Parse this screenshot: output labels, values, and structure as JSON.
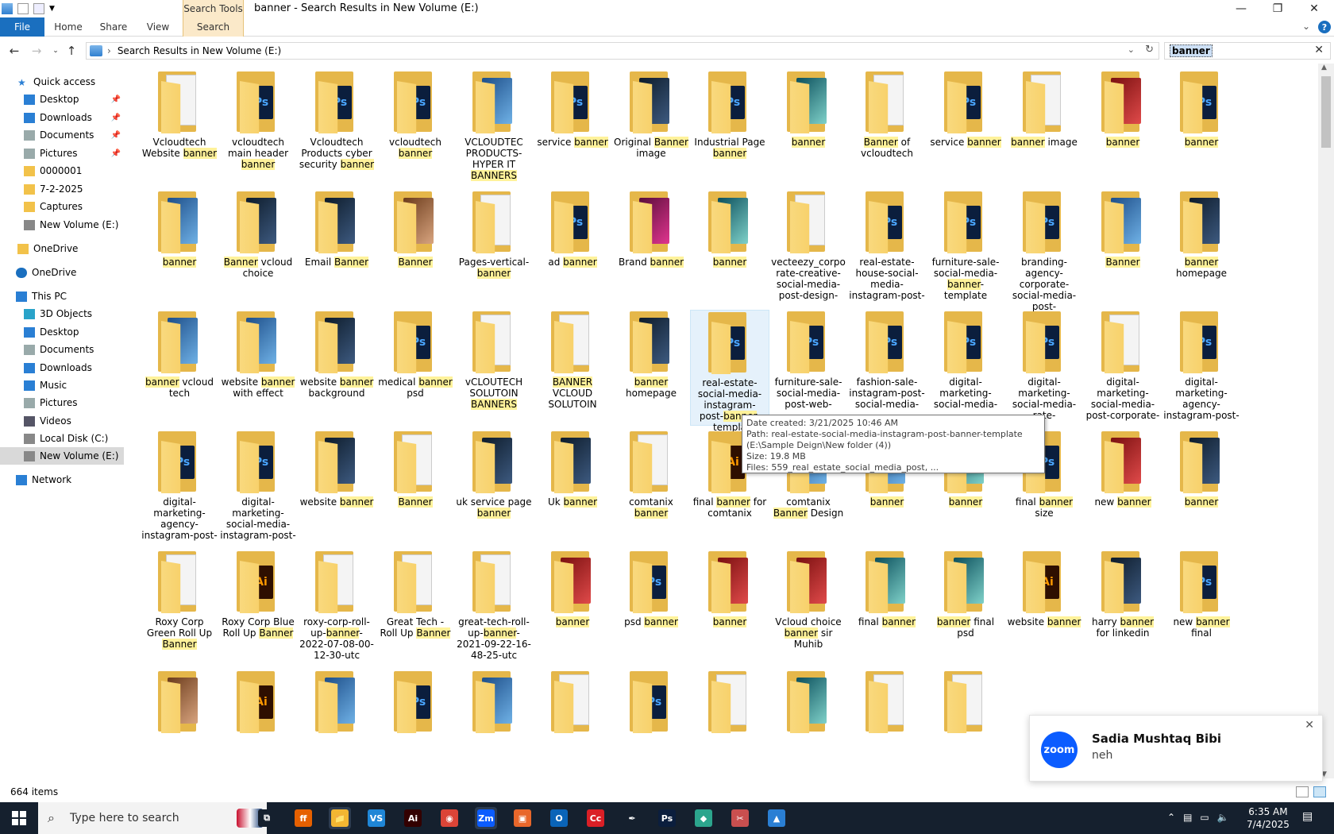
{
  "window": {
    "title": "banner - Search Results in New Volume (E:)",
    "context_group": "Search Tools",
    "min": "—",
    "max": "❐",
    "close": "✕"
  },
  "ribbon": {
    "tabs": [
      "File",
      "Home",
      "Share",
      "View",
      "Search"
    ],
    "help": "?"
  },
  "address": {
    "path": "Search Results in New Volume (E:)",
    "search_value": "banner"
  },
  "nav": {
    "items": [
      {
        "label": "Quick access",
        "icon": "star-icon"
      },
      {
        "label": "Desktop",
        "icon": "desktop-icon",
        "pinned": true
      },
      {
        "label": "Downloads",
        "icon": "download-icon",
        "pinned": true
      },
      {
        "label": "Documents",
        "icon": "documents-icon",
        "pinned": true
      },
      {
        "label": "Pictures",
        "icon": "pictures-icon",
        "pinned": true
      },
      {
        "label": "0000001",
        "icon": "folder-icon"
      },
      {
        "label": "7-2-2025",
        "icon": "folder-icon"
      },
      {
        "label": "Captures",
        "icon": "folder-icon"
      },
      {
        "label": "New Volume (E:)",
        "icon": "drive-icon"
      },
      {
        "label": "OneDrive",
        "icon": "folder-icon"
      },
      {
        "label": "OneDrive",
        "icon": "cloud-icon"
      },
      {
        "label": "This PC",
        "icon": "pc-icon"
      },
      {
        "label": "3D Objects",
        "icon": "3d-objects-icon"
      },
      {
        "label": "Desktop",
        "icon": "desktop-icon"
      },
      {
        "label": "Documents",
        "icon": "documents-icon"
      },
      {
        "label": "Downloads",
        "icon": "download-icon"
      },
      {
        "label": "Music",
        "icon": "music-icon"
      },
      {
        "label": "Pictures",
        "icon": "pictures-icon"
      },
      {
        "label": "Videos",
        "icon": "videos-icon"
      },
      {
        "label": "Local Disk (C:)",
        "icon": "drive-icon"
      },
      {
        "label": "New Volume (E:)",
        "icon": "drive-icon",
        "selected": true
      },
      {
        "label": "Network",
        "icon": "network-icon"
      }
    ]
  },
  "files": [
    [
      {
        "pre": "Vcloudtech Website ",
        "hl": "banner",
        "post": "",
        "kind": "doc"
      },
      {
        "pre": "vcloudtech main header ",
        "hl": "banner",
        "post": "",
        "kind": "psd"
      },
      {
        "pre": "Vcloudtech Products cyber security ",
        "hl": "banner",
        "post": "",
        "kind": "psd"
      },
      {
        "pre": "vcloudtech ",
        "hl": "banner",
        "post": "",
        "kind": "psd"
      },
      {
        "pre": "VCLOUDTEC PRODUCTS-HYPER IT ",
        "hl": "BANNERS",
        "post": "",
        "kind": "img-blue"
      },
      {
        "pre": "service ",
        "hl": "banner",
        "post": "",
        "kind": "psd"
      },
      {
        "pre": "Original ",
        "hl": "Banner",
        "post": " image",
        "kind": "img-dark"
      },
      {
        "pre": "Industrial Page ",
        "hl": "banner",
        "post": "",
        "kind": "psd"
      },
      {
        "pre": "",
        "hl": "banner",
        "post": "",
        "kind": "img-teal"
      },
      {
        "pre": "",
        "hl": "Banner",
        "post": " of vcloudtech",
        "kind": "doc"
      },
      {
        "pre": "service ",
        "hl": "banner",
        "post": "",
        "kind": "psd"
      },
      {
        "pre": "",
        "hl": "banner",
        "post": " image",
        "kind": "doc"
      },
      {
        "pre": "",
        "hl": "banner",
        "post": "",
        "kind": "img-red"
      },
      {
        "pre": "",
        "hl": "banner",
        "post": "",
        "kind": "psd"
      }
    ],
    [
      {
        "pre": "",
        "hl": "banner",
        "post": "",
        "kind": "img-blue"
      },
      {
        "pre": "",
        "hl": "Banner",
        "post": " vcloud choice",
        "kind": "img-dark"
      },
      {
        "pre": "Email ",
        "hl": "Banner",
        "post": "",
        "kind": "img-dark"
      },
      {
        "pre": "",
        "hl": "Banner",
        "post": "",
        "kind": "img-brown"
      },
      {
        "pre": "Pages-vertical-",
        "hl": "banner",
        "post": "",
        "kind": "doc"
      },
      {
        "pre": "ad ",
        "hl": "banner",
        "post": "",
        "kind": "psd"
      },
      {
        "pre": "Brand ",
        "hl": "banner",
        "post": "",
        "kind": "img-pink"
      },
      {
        "pre": "",
        "hl": "banner",
        "post": "",
        "kind": "img-teal"
      },
      {
        "pre": "vecteezy_corporate-creative-social-media-post-design-",
        "hl": "",
        "post": "",
        "kind": "doc"
      },
      {
        "pre": "real-estate-house-social-media-instagram-post-",
        "hl": "",
        "post": "",
        "kind": "psd"
      },
      {
        "pre": "furniture-sale-social-media-",
        "hl": "banner",
        "post": "-template",
        "kind": "psd"
      },
      {
        "pre": "branding-agency-corporate-social-media-post-",
        "hl": "",
        "post": "",
        "kind": "psd"
      },
      {
        "pre": "",
        "hl": "Banner",
        "post": "",
        "kind": "img-blue"
      },
      {
        "pre": "",
        "hl": "banner",
        "post": " homepage",
        "kind": "img-dark"
      }
    ],
    [
      {
        "pre": "",
        "hl": "banner",
        "post": " vcloud tech",
        "kind": "img-blue"
      },
      {
        "pre": "website ",
        "hl": "banner",
        "post": " with effect",
        "kind": "img-blue"
      },
      {
        "pre": "website ",
        "hl": "banner",
        "post": " background",
        "kind": "img-dark"
      },
      {
        "pre": "medical ",
        "hl": "banner",
        "post": " psd",
        "kind": "psd"
      },
      {
        "pre": "vCLOUTECH SOLUTOIN ",
        "hl": "BANNERS",
        "post": "",
        "kind": "doc"
      },
      {
        "pre": "",
        "hl": "BANNER",
        "post": " VCLOUD SOLUTOIN",
        "kind": "doc"
      },
      {
        "pre": "",
        "hl": "banner",
        "post": " homepage",
        "kind": "img-dark"
      },
      {
        "pre": "real-estate-social-media-instagram-post-",
        "hl": "banner",
        "post": "-templa",
        "kind": "psd",
        "hover": true
      },
      {
        "pre": "furniture-sale-social-media-post-web-",
        "hl": "",
        "post": "",
        "kind": "psd"
      },
      {
        "pre": "fashion-sale-instagram-post-social-media-",
        "hl": "",
        "post": "",
        "kind": "psd"
      },
      {
        "pre": "digital-marketing-social-media-",
        "hl": "",
        "post": "",
        "kind": "psd"
      },
      {
        "pre": "digital-marketing-social-media-",
        "hl": "",
        "post": "rate-",
        "kind": "psd"
      },
      {
        "pre": "digital-marketing-social-media-post-corporate-",
        "hl": "",
        "post": "",
        "kind": "doc"
      },
      {
        "pre": "digital-marketing-agency-instagram-post-",
        "hl": "",
        "post": "",
        "kind": "psd"
      }
    ],
    [
      {
        "pre": "digital-marketing-agency-instagram-post-",
        "hl": "",
        "post": "",
        "kind": "psd"
      },
      {
        "pre": "digital-marketing-social-media-instagram-post-",
        "hl": "",
        "post": "",
        "kind": "psd"
      },
      {
        "pre": "website ",
        "hl": "banner",
        "post": "",
        "kind": "img-dark"
      },
      {
        "pre": "",
        "hl": "Banner",
        "post": "",
        "kind": "doc"
      },
      {
        "pre": "uk service page ",
        "hl": "banner",
        "post": "",
        "kind": "img-dark"
      },
      {
        "pre": "Uk ",
        "hl": "banner",
        "post": "",
        "kind": "img-dark"
      },
      {
        "pre": "comtanix ",
        "hl": "banner",
        "post": "",
        "kind": "doc"
      },
      {
        "pre": "final ",
        "hl": "banner",
        "post": " for comtanix",
        "kind": "ai"
      },
      {
        "pre": "comtanix ",
        "hl": "Banner",
        "post": " Design",
        "kind": "img-blue"
      },
      {
        "pre": "",
        "hl": "banner",
        "post": "",
        "kind": "img-blue"
      },
      {
        "pre": "",
        "hl": "banner",
        "post": "",
        "kind": "img-teal"
      },
      {
        "pre": "final ",
        "hl": "banner",
        "post": " size",
        "kind": "psd"
      },
      {
        "pre": "new ",
        "hl": "banner",
        "post": "",
        "kind": "img-red"
      },
      {
        "pre": "",
        "hl": "banner",
        "post": "",
        "kind": "img-dark"
      }
    ],
    [
      {
        "pre": "Roxy Corp Green Roll Up ",
        "hl": "Banner",
        "post": "",
        "kind": "doc"
      },
      {
        "pre": "Roxy Corp Blue Roll Up ",
        "hl": "Banner",
        "post": "",
        "kind": "ai"
      },
      {
        "pre": "roxy-corp-roll-up-",
        "hl": "banner",
        "post": "-2022-07-08-00-12-30-utc",
        "kind": "doc"
      },
      {
        "pre": "Great Tech - Roll Up ",
        "hl": "Banner",
        "post": "",
        "kind": "doc"
      },
      {
        "pre": "great-tech-roll-up-",
        "hl": "banner",
        "post": "-2021-09-22-16-48-25-utc",
        "kind": "doc"
      },
      {
        "pre": "",
        "hl": "banner",
        "post": "",
        "kind": "img-red"
      },
      {
        "pre": "psd ",
        "hl": "banner",
        "post": "",
        "kind": "psd"
      },
      {
        "pre": "",
        "hl": "banner",
        "post": "",
        "kind": "img-red"
      },
      {
        "pre": "Vcloud choice ",
        "hl": "banner",
        "post": " sir Muhib",
        "kind": "img-red"
      },
      {
        "pre": "final ",
        "hl": "banner",
        "post": "",
        "kind": "img-teal"
      },
      {
        "pre": "",
        "hl": "banner",
        "post": " final psd",
        "kind": "img-teal"
      },
      {
        "pre": "website ",
        "hl": "banner",
        "post": "",
        "kind": "ai"
      },
      {
        "pre": "harry ",
        "hl": "banner",
        "post": " for linkedin",
        "kind": "img-dark"
      },
      {
        "pre": "new ",
        "hl": "banner",
        "post": " final",
        "kind": "psd"
      }
    ],
    [
      {
        "pre": "",
        "hl": "",
        "post": "",
        "kind": "img-brown"
      },
      {
        "pre": "",
        "hl": "",
        "post": "",
        "kind": "ai"
      },
      {
        "pre": "",
        "hl": "",
        "post": "",
        "kind": "img-blue"
      },
      {
        "pre": "",
        "hl": "",
        "post": "",
        "kind": "psd"
      },
      {
        "pre": "",
        "hl": "",
        "post": "",
        "kind": "img-blue"
      },
      {
        "pre": "",
        "hl": "",
        "post": "",
        "kind": "doc"
      },
      {
        "pre": "",
        "hl": "",
        "post": "",
        "kind": "psd"
      },
      {
        "pre": "",
        "hl": "",
        "post": "",
        "kind": "doc"
      },
      {
        "pre": "",
        "hl": "",
        "post": "",
        "kind": "img-teal"
      },
      {
        "pre": "",
        "hl": "",
        "post": "",
        "kind": "doc"
      },
      {
        "pre": "",
        "hl": "",
        "post": "",
        "kind": "doc"
      }
    ]
  ],
  "tooltip": {
    "line1": "Date created: 3/21/2025 10:46 AM",
    "line2": "Path: real-estate-social-media-instagram-post-banner-template (E:\\Sample Deign\\New folder (4))",
    "line3": "Size: 19.8 MB",
    "line4": "Files: 559_real_estate_social_media_post, ..."
  },
  "status": {
    "count": "664 items"
  },
  "toast": {
    "app": "zoom",
    "name": "Sadia Mushtaq Bibi",
    "message": "neh"
  },
  "taskbar": {
    "search_placeholder": "Type here to search",
    "apps": [
      {
        "name": "task-view-icon",
        "label": "⧉",
        "color": "#15202e"
      },
      {
        "name": "firefox-icon",
        "label": "ff",
        "color": "#e66000"
      },
      {
        "name": "file-explorer-icon",
        "label": "📁",
        "color": "#f2b632",
        "active": true
      },
      {
        "name": "vscode-icon",
        "label": "VS",
        "color": "#1f86d6"
      },
      {
        "name": "illustrator-icon",
        "label": "Ai",
        "color": "#330000"
      },
      {
        "name": "chrome-icon",
        "label": "◉",
        "color": "#db4437"
      },
      {
        "name": "zoom-taskbar-icon",
        "label": "Zm",
        "color": "#0b5cff",
        "active": true
      },
      {
        "name": "app-orange-icon",
        "label": "▣",
        "color": "#e8672b"
      },
      {
        "name": "outlook-icon",
        "label": "O",
        "color": "#0a64b8"
      },
      {
        "name": "creative-cloud-icon",
        "label": "Cc",
        "color": "#da1f26"
      },
      {
        "name": "pen-tool-icon",
        "label": "✒",
        "color": "#15202e"
      },
      {
        "name": "photoshop-icon",
        "label": "Ps",
        "color": "#0b1e3d"
      },
      {
        "name": "app-teal-icon",
        "label": "◆",
        "color": "#2ca58d"
      },
      {
        "name": "snipping-tool-icon",
        "label": "✂",
        "color": "#c94f4f"
      },
      {
        "name": "app-blue-icon",
        "label": "▲",
        "color": "#2a7fd4"
      }
    ],
    "time": "6:35 AM",
    "date": "7/4/2025"
  },
  "colors": {
    "accent": "#1a6fbf",
    "highlight": "#fff29a",
    "taskbar": "#15202e"
  }
}
